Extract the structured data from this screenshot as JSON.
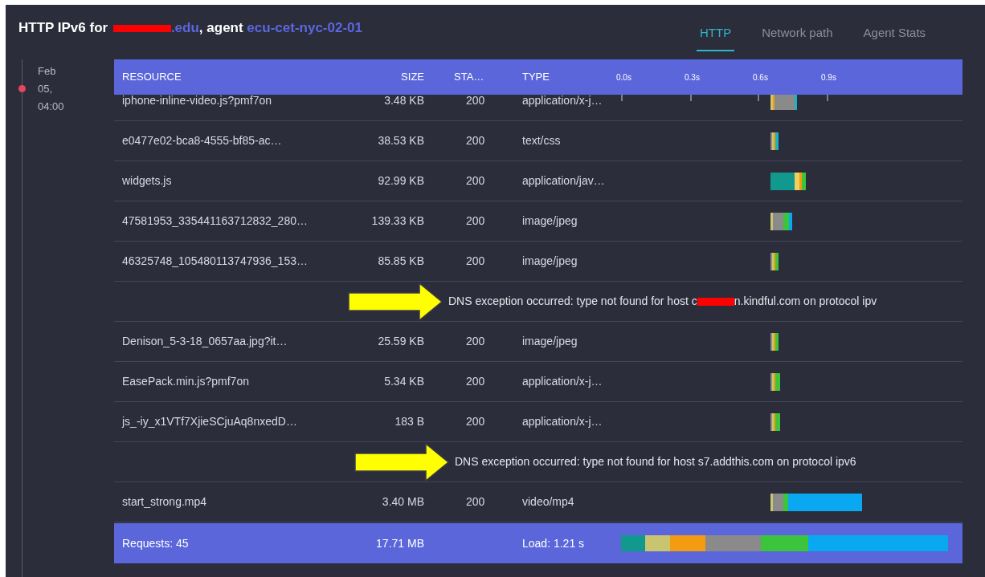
{
  "header": {
    "title_prefix": "HTTP IPv6 for ",
    "domain_redacted": true,
    "domain": ".edu",
    "title_middle": ", agent ",
    "agent": "ecu-cet-nyc-02-01"
  },
  "tabs": [
    {
      "label": "HTTP",
      "selected": true
    },
    {
      "label": "Network path",
      "selected": false
    },
    {
      "label": "Agent Stats",
      "selected": false
    }
  ],
  "timeline": {
    "date": "Feb 05, 04:00"
  },
  "table": {
    "columns": [
      "RESOURCE",
      "SIZE",
      "STA…",
      "TYPE"
    ],
    "time_axis": [
      "0.0s",
      "0.3s",
      "0.6s",
      "0.9s"
    ],
    "rows": [
      {
        "kind": "request",
        "resource": "iphone-inline-video.js?pmf7on",
        "size": "3.48 KB",
        "status": "200",
        "type": "application/x-j…"
      },
      {
        "kind": "request",
        "resource": "e0477e02-bca8-4555-bf85-ac…",
        "size": "38.53 KB",
        "status": "200",
        "type": "text/css"
      },
      {
        "kind": "request",
        "resource": "widgets.js",
        "size": "92.99 KB",
        "status": "200",
        "type": "application/jav…"
      },
      {
        "kind": "request",
        "resource": "47581953_335441163712832_280…",
        "size": "139.33 KB",
        "status": "200",
        "type": "image/jpeg"
      },
      {
        "kind": "request",
        "resource": "46325748_105480113747936_153…",
        "size": "85.85 KB",
        "status": "200",
        "type": "image/jpeg"
      },
      {
        "kind": "error",
        "message": "DNS exception occurred: type not found for host c",
        "redacted": true,
        "message_after": "n.kindful.com on protocol ipv"
      },
      {
        "kind": "request",
        "resource": "Denison_5-3-18_0657aa.jpg?it…",
        "size": "25.59 KB",
        "status": "200",
        "type": "image/jpeg"
      },
      {
        "kind": "request",
        "resource": "EasePack.min.js?pmf7on",
        "size": "5.34 KB",
        "status": "200",
        "type": "application/x-j…"
      },
      {
        "kind": "request",
        "resource": "js_-iy_x1VTf7XjieSCjuAq8nxedD…",
        "size": "183 B",
        "status": "200",
        "type": "application/x-j…"
      },
      {
        "kind": "error",
        "message": "DNS exception occurred: type not found for host s7.addthis.com on protocol ipv6",
        "redacted": false
      },
      {
        "kind": "request",
        "resource": "start_strong.mp4",
        "size": "3.40 MB",
        "status": "200",
        "type": "video/mp4"
      }
    ],
    "footer": {
      "requests": "Requests: 45",
      "size": "17.71 MB",
      "load": "Load: 1.21 s"
    }
  }
}
